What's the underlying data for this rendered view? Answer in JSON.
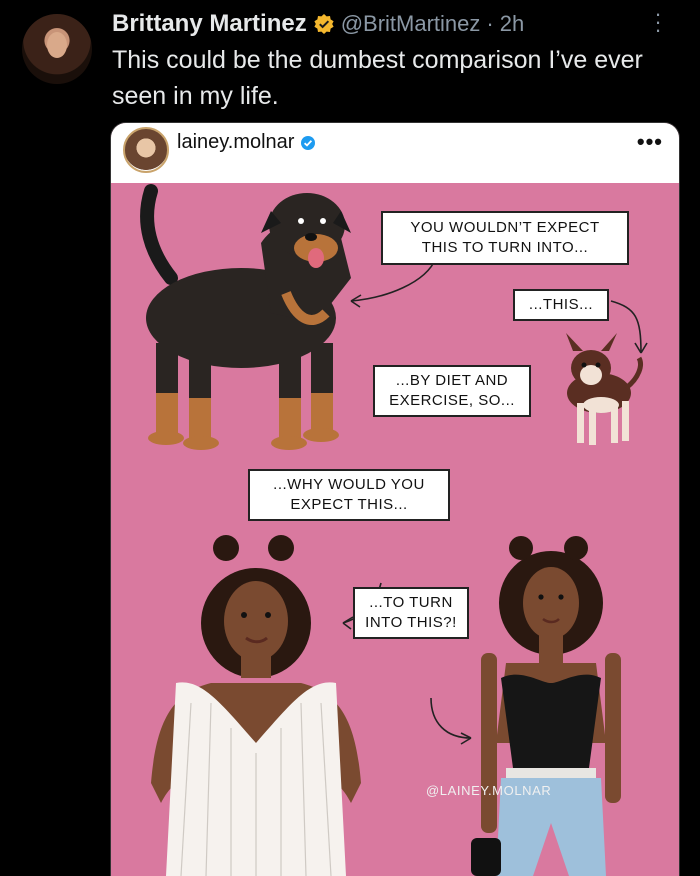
{
  "tweet": {
    "name": "Brittany Martinez",
    "handle": "@BritMartinez",
    "separator": "·",
    "time": "2h",
    "text": "This could be the dumbest comparison I’ve ever seen in my life."
  },
  "embed": {
    "username": "lainey.molnar",
    "more": "•••",
    "bubbles": {
      "b1": "YOU WOULDN’T EXPECT THIS TO TURN INTO...",
      "b2": "...THIS...",
      "b3": "...BY DIET AND EXERCISE, SO...",
      "b4": "...WHY WOULD YOU EXPECT THIS...",
      "b5": "...TO TURN INTO THIS?!"
    },
    "watermark": "@LAINEY.MOLNAR"
  },
  "colors": {
    "background": "#000000",
    "art_background": "#d9799f",
    "verified": "#f5b82e",
    "ig_verified": "#1d9bf0"
  }
}
